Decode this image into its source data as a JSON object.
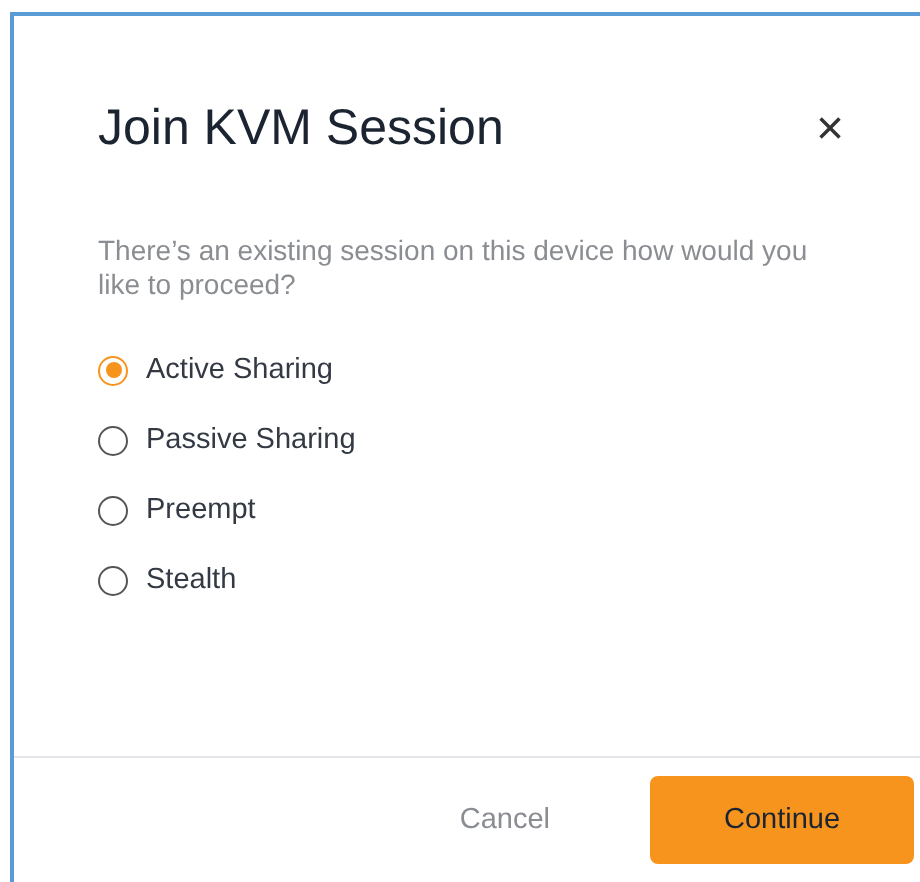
{
  "dialog": {
    "title": "Join KVM Session",
    "close": "×",
    "message": "There’s an existing session on this device how would you like to proceed?",
    "options": [
      {
        "label": "Active Sharing",
        "selected": true
      },
      {
        "label": "Passive Sharing",
        "selected": false
      },
      {
        "label": "Preempt",
        "selected": false
      },
      {
        "label": "Stealth",
        "selected": false
      }
    ],
    "buttons": [
      {
        "label": "Cancel",
        "kind": "secondary"
      },
      {
        "label": "Continue",
        "kind": "primary"
      }
    ]
  }
}
